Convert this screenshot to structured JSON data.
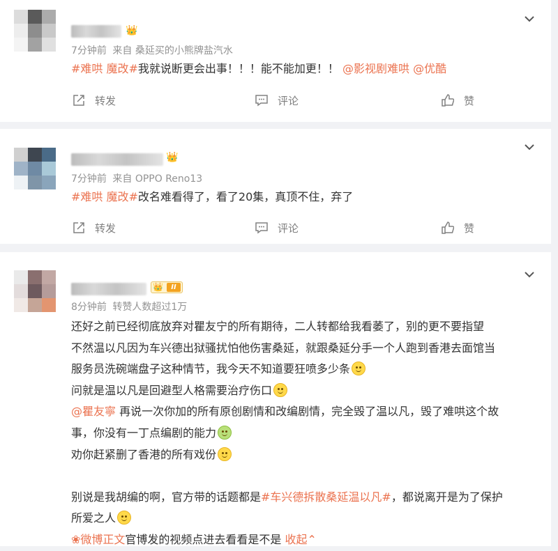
{
  "comments": [
    {
      "time": "7分钟前",
      "source": "来自 桑延买的小熊牌盐汽水",
      "topic": "#难哄 魔改#",
      "text": "我就说断更会出事！！！能不能加更！！",
      "mentions": [
        "@影视剧难哄",
        "@优酷"
      ],
      "actions": {
        "repost": "转发",
        "comment": "评论",
        "like": "赞"
      }
    },
    {
      "time": "7分钟前",
      "source": "来自 OPPO Reno13",
      "topic": "#难哄 魔改#",
      "text": "改名难看得了，看了20集，真顶不住，弃了",
      "actions": {
        "repost": "转发",
        "comment": "评论",
        "like": "赞"
      }
    },
    {
      "time": "8分钟前",
      "source": "转赞人数超过1万",
      "badge_level": "II",
      "lines": [
        "还好之前已经彻底放弃对瞿友宁的所有期待，二人转都给我看萎了，别的更不要指望",
        "不然温以凡因为车兴德出狱骚扰怕他伤害桑延，就跟桑延分手一个人跑到香港去面馆当",
        "服务员洗碗端盘子这种情节，我今天不知道要狂喷多少条",
        "问就是温以凡是回避型人格需要治疗伤口",
        "再说一次你加的所有原创剧情和改编剧情，完全毁了温以凡，毁了难哄这个故",
        "事，你没有一丁点编剧的能力",
        "劝你赶紧删了香港的所有戏份",
        "别说是我胡编的啊，官方带的话题都是",
        "，都说离开是为了保护",
        "所爱之人",
        "官博发的视频点进去看看是不是"
      ],
      "mention": "@瞿友寧",
      "topic": "#车兴德拆散桑延温以凡#",
      "link_text": "微博正文",
      "collapse": "收起"
    }
  ],
  "colors": {
    "accent": "#eb7350",
    "meta": "#939393",
    "bg": "#f1f2f5"
  }
}
